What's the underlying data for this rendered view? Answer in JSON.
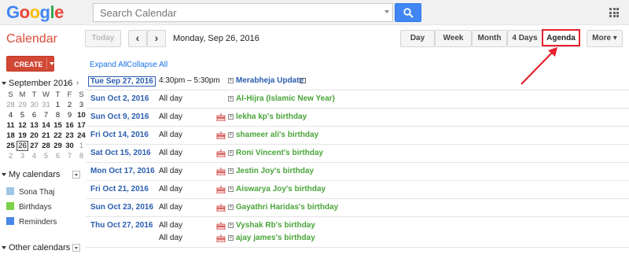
{
  "logo": {
    "letters": [
      "G",
      "o",
      "o",
      "g",
      "l",
      "e"
    ],
    "colors": [
      "#4285f4",
      "#ea4335",
      "#fbbc05",
      "#4285f4",
      "#34a853",
      "#ea4335"
    ]
  },
  "search": {
    "placeholder": "Search Calendar"
  },
  "app_title": "Calendar",
  "toolbar": {
    "today": "Today",
    "prev": "‹",
    "next": "›",
    "current_date": "Monday, Sep 26, 2016",
    "views": [
      "Day",
      "Week",
      "Month",
      "4 Days",
      "Agenda"
    ],
    "more": "More ▾",
    "highlight_color": "#e8212e"
  },
  "create_label": "CREATE",
  "mini_calendar": {
    "title": "September 2016",
    "nav_prev": "‹",
    "nav_next": "›",
    "weekdays": [
      "S",
      "M",
      "T",
      "W",
      "T",
      "F",
      "S"
    ],
    "weeks": [
      [
        "28",
        "29",
        "30",
        "31",
        "1",
        "2",
        "3"
      ],
      [
        "4",
        "5",
        "6",
        "7",
        "8",
        "9",
        "10"
      ],
      [
        "11",
        "12",
        "13",
        "14",
        "15",
        "16",
        "17"
      ],
      [
        "18",
        "19",
        "20",
        "21",
        "22",
        "23",
        "24"
      ],
      [
        "25",
        "26",
        "27",
        "28",
        "29",
        "30",
        "1"
      ],
      [
        "2",
        "3",
        "4",
        "5",
        "6",
        "7",
        "8"
      ]
    ]
  },
  "my_calendars": {
    "title": "My calendars",
    "items": [
      {
        "label": "Sona Thaj",
        "color": "#9fc6e7"
      },
      {
        "label": "Birthdays",
        "color": "#7bd148"
      },
      {
        "label": "Reminders",
        "color": "#4986e7"
      }
    ]
  },
  "other_calendars": {
    "title": "Other calendars"
  },
  "expand_all": "Expand All",
  "collapse_all": "Collapse All",
  "events": [
    {
      "date": "Tue Sep 27, 2016",
      "time": "4:30pm – 5:30pm",
      "title": "Merabheja Update",
      "kind": "event",
      "selected": true
    },
    {
      "date": "Sun Oct 2, 2016",
      "time": "All day",
      "title": "Al-Hijra (Islamic New Year)",
      "kind": "holiday"
    },
    {
      "date": "Sun Oct 9, 2016",
      "time": "All day",
      "title": "lekha kp's birthday",
      "kind": "birthday"
    },
    {
      "date": "Fri Oct 14, 2016",
      "time": "All day",
      "title": "shameer ali's birthday",
      "kind": "birthday"
    },
    {
      "date": "Sat Oct 15, 2016",
      "time": "All day",
      "title": "Roni Vincent's birthday",
      "kind": "birthday"
    },
    {
      "date": "Mon Oct 17, 2016",
      "time": "All day",
      "title": "Jestin Joy's birthday",
      "kind": "birthday"
    },
    {
      "date": "Fri Oct 21, 2016",
      "time": "All day",
      "title": "Aiswarya Joy's birthday",
      "kind": "birthday"
    },
    {
      "date": "Sun Oct 23, 2016",
      "time": "All day",
      "title": "Gayathri Haridas's birthday",
      "kind": "birthday"
    },
    {
      "date": "Thu Oct 27, 2016",
      "time": "All day",
      "title": "Vyshak Rb's birthday",
      "kind": "birthday"
    },
    {
      "date": "",
      "time": "All day",
      "title": "ajay james's birthday",
      "kind": "birthday"
    }
  ]
}
